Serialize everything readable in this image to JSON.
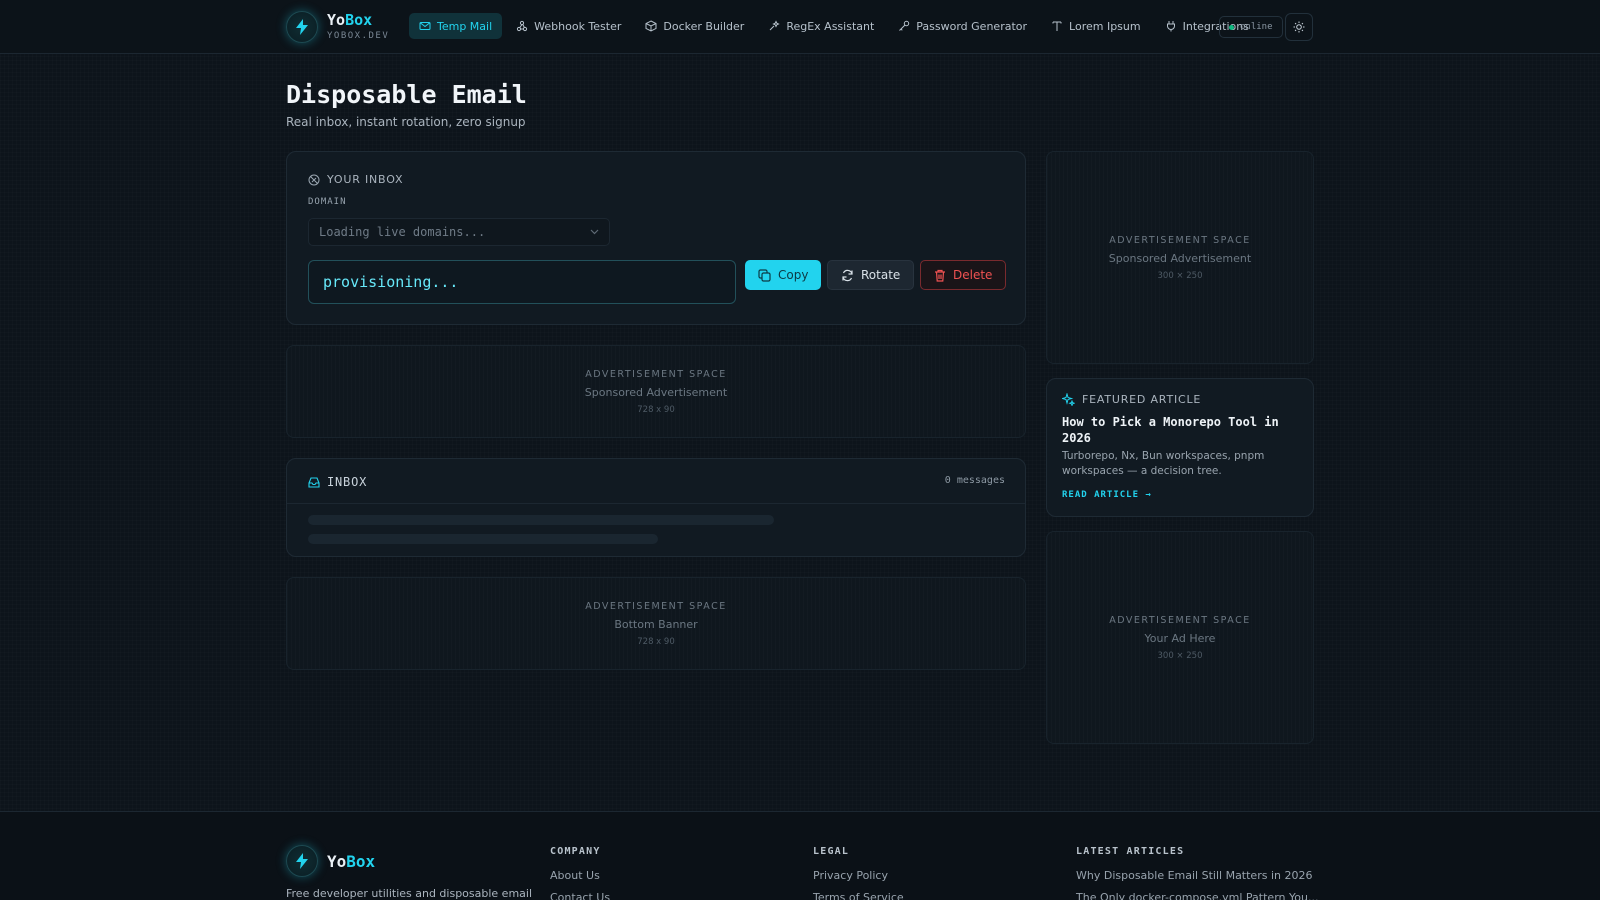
{
  "brand": {
    "name_main": "Yo",
    "name_accent": "Box",
    "subtitle": "YOBOX.DEV"
  },
  "nav": [
    {
      "label": "Temp Mail",
      "icon": "mail-icon",
      "active": true
    },
    {
      "label": "Webhook Tester",
      "icon": "webhook-icon"
    },
    {
      "label": "Docker Builder",
      "icon": "box-icon"
    },
    {
      "label": "RegEx Assistant",
      "icon": "regex-icon"
    },
    {
      "label": "Password Generator",
      "icon": "key-icon"
    },
    {
      "label": "Lorem Ipsum",
      "icon": "text-icon"
    },
    {
      "label": "Integrations",
      "icon": "plug-icon"
    }
  ],
  "status": {
    "label": "online",
    "color": "#10b981"
  },
  "page": {
    "title": "Disposable Email",
    "subtitle": "Real inbox, instant rotation, zero signup"
  },
  "inbox_card": {
    "label": "YOUR INBOX",
    "domain_label": "DOMAIN",
    "domain_placeholder": "Loading live domains...",
    "email_value": "provisioning...",
    "copy_label": "Copy",
    "rotate_label": "Rotate",
    "delete_label": "Delete"
  },
  "ads": {
    "top": {
      "title": "ADVERTISEMENT SPACE",
      "sub": "Sponsored Advertisement",
      "size": "728 x 90"
    },
    "bottom": {
      "title": "ADVERTISEMENT SPACE",
      "sub": "Bottom Banner",
      "size": "728 x 90"
    },
    "side1": {
      "title": "ADVERTISEMENT SPACE",
      "sub": "Sponsored Advertisement",
      "size": "300 × 250"
    },
    "side2": {
      "title": "ADVERTISEMENT SPACE",
      "sub": "Your Ad Here",
      "size": "300 × 250"
    }
  },
  "inbox_list": {
    "label": "INBOX",
    "count": "0 messages"
  },
  "featured": {
    "label": "FEATURED ARTICLE",
    "title": "How to Pick a Monorepo Tool in 2026",
    "desc": "Turborepo, Nx, Bun workspaces, pnpm workspaces — a decision tree.",
    "link": "READ ARTICLE →"
  },
  "footer": {
    "desc": "Free developer utilities and disposable email",
    "company": {
      "title": "COMPANY",
      "links": [
        "About Us",
        "Contact Us"
      ]
    },
    "legal": {
      "title": "LEGAL",
      "links": [
        "Privacy Policy",
        "Terms of Service"
      ]
    },
    "articles": {
      "title": "LATEST ARTICLES",
      "links": [
        "Why Disposable Email Still Matters in 2026",
        "The Only docker-compose.yml Pattern You..."
      ]
    }
  },
  "colors": {
    "accent": "#22d3ee",
    "danger": "#f05252",
    "background": "#0d141b"
  }
}
